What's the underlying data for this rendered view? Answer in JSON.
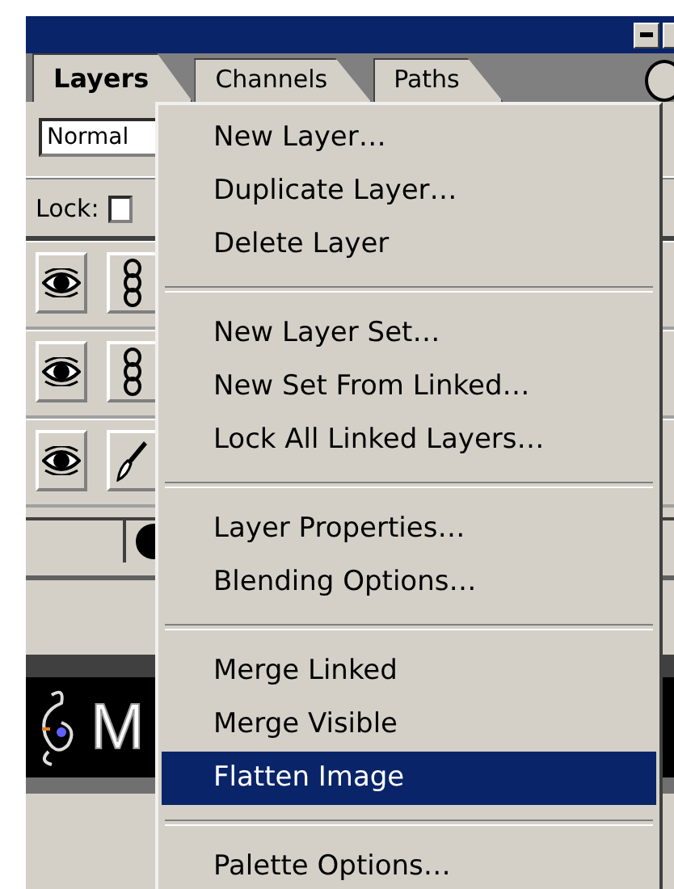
{
  "tabs": [
    {
      "label": "Layers",
      "selected": true
    },
    {
      "label": "Channels",
      "selected": false
    },
    {
      "label": "Paths",
      "selected": false
    }
  ],
  "blend_mode": {
    "value": "Normal"
  },
  "lock": {
    "label": "Lock:",
    "checked": false
  },
  "layers": [
    {
      "visible": true,
      "kind": "linked"
    },
    {
      "visible": true,
      "kind": "linked"
    },
    {
      "visible": true,
      "kind": "brush"
    }
  ],
  "document": {
    "text": "M"
  },
  "menu": [
    {
      "kind": "item",
      "label": "New Layer…",
      "selected": false
    },
    {
      "kind": "item",
      "label": "Duplicate Layer…",
      "selected": false
    },
    {
      "kind": "item",
      "label": "Delete Layer",
      "selected": false
    },
    {
      "kind": "separator"
    },
    {
      "kind": "item",
      "label": "New Layer Set…",
      "selected": false
    },
    {
      "kind": "item",
      "label": "New Set From Linked…",
      "selected": false
    },
    {
      "kind": "item",
      "label": "Lock All Linked Layers…",
      "selected": false
    },
    {
      "kind": "separator"
    },
    {
      "kind": "item",
      "label": "Layer Properties…",
      "selected": false
    },
    {
      "kind": "item",
      "label": "Blending Options…",
      "selected": false
    },
    {
      "kind": "separator"
    },
    {
      "kind": "item",
      "label": "Merge Linked",
      "selected": false
    },
    {
      "kind": "item",
      "label": "Merge Visible",
      "selected": false
    },
    {
      "kind": "item",
      "label": "Flatten Image",
      "selected": true
    },
    {
      "kind": "separator"
    },
    {
      "kind": "item",
      "label": "Palette Options…",
      "selected": false
    }
  ]
}
